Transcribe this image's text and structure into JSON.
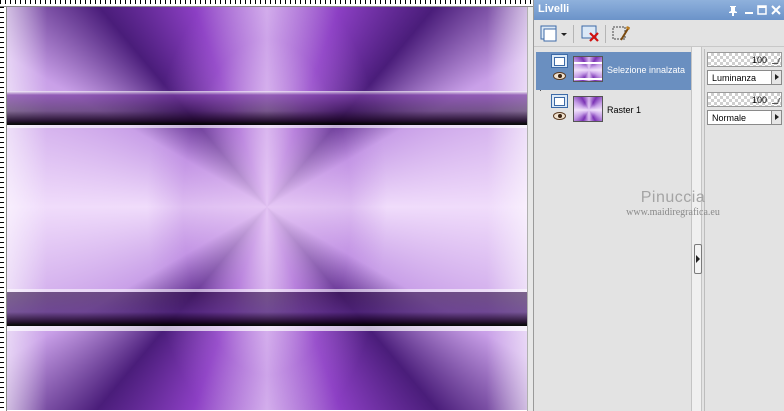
{
  "palette": {
    "title": "Livelli",
    "title_buttons": {
      "pin": "pin-icon",
      "minimize": "minimize-icon",
      "maximize": "maximize-icon",
      "close": "close-icon"
    },
    "toolbar": {
      "new_layer_icon": "new-layer-icon",
      "delete_layer_icon": "delete-layer-icon",
      "edit_selection_icon": "edit-selection-icon"
    },
    "layers": [
      {
        "name": "Selezione innalzata",
        "opacity": "100",
        "blend_mode": "Luminanza",
        "selected": true
      },
      {
        "name": "Raster 1",
        "opacity": "100",
        "blend_mode": "Normale",
        "selected": false
      }
    ]
  },
  "watermark": {
    "name": "Pinuccia",
    "url": "www.maidiregrafica.eu"
  },
  "colors": {
    "titlebar": "#6b93c9",
    "selected_row": "#6a8fc0",
    "palette_bg": "#e3e3e3",
    "accent_purple": "#8c3fc4"
  }
}
